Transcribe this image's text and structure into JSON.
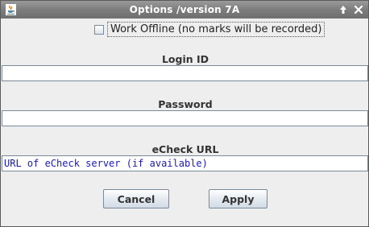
{
  "window": {
    "title": "Options /version 7A"
  },
  "options": {
    "offline_label": "Work Offline (no marks will be recorded)",
    "offline_checked": false
  },
  "login": {
    "label": "Login ID",
    "value": ""
  },
  "password": {
    "label": "Password",
    "value": ""
  },
  "echeck": {
    "label": "eCheck URL",
    "placeholder": "URL of eCheck server (if available)"
  },
  "buttons": {
    "cancel_label": "Cancel",
    "apply_label": "Apply"
  },
  "icons": {
    "app": "java-cup-icon",
    "maximize": "arrow-up-icon",
    "close": "close-icon"
  },
  "colors": {
    "titlebar": "#7d7d7d",
    "placeholder_text": "#1a1ab8",
    "background": "#eeeeee"
  }
}
